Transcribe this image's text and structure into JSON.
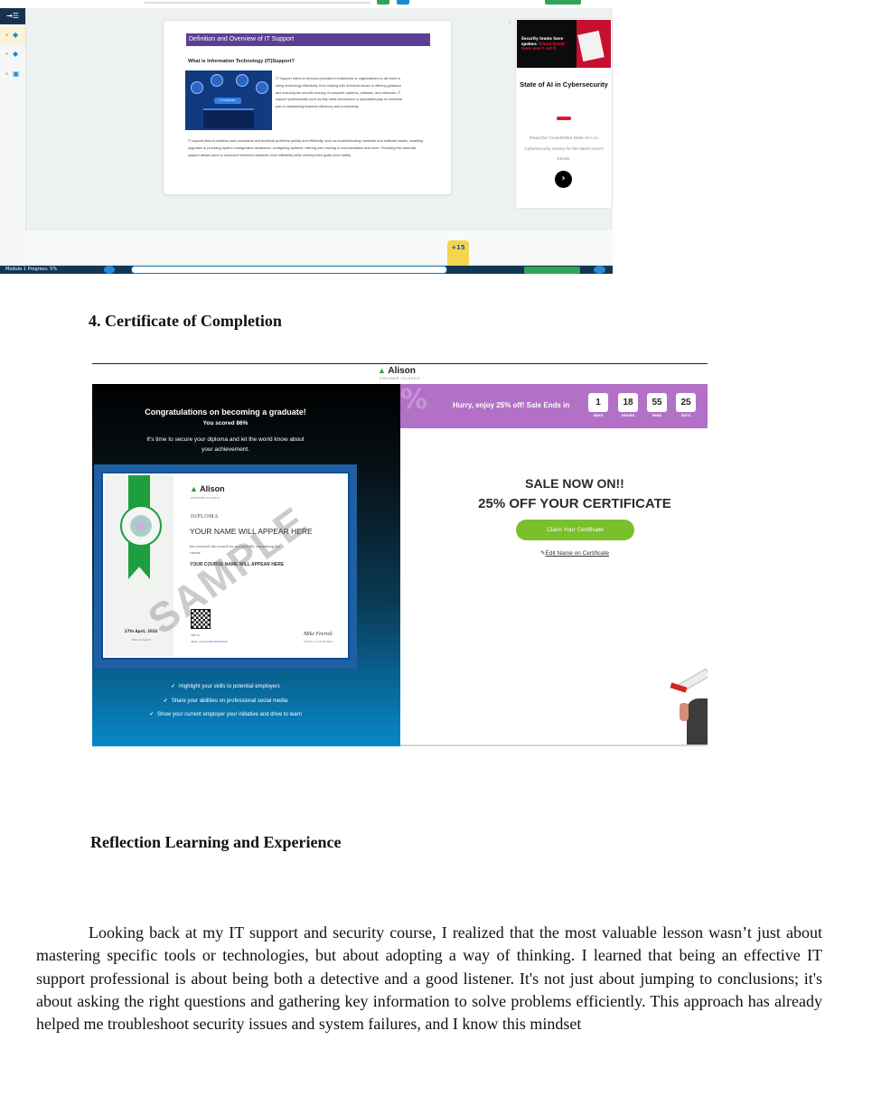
{
  "screenshot1": {
    "lesson_title": "Definition and Overview of IT Support",
    "question": "What is Information Technology (IT)Support?",
    "image_tag": "IT SUPPORT",
    "paragraph1": "IT Support refers to services provided to individuals or organizations to aid them in using technology effectively, from helping with technical issues to offering guidance and ensuring the smooth running of computer systems, software, and networks. IT support professionals such as help desk technicians or specialists play an essential part in maintaining business efficiency and productivity.",
    "paragraph2": "IT support aims to address user complaints and technical problems quickly and efficiently, such as troubleshooting hardware and software issues, installing upgrades or providing system configuration assistance, configuring systems, offering user training or documentation and more. Providing this essential support allows users to overcome technical obstacles more efficiently while meeting their goals more swiftly.",
    "ad_image_text": "Security teams have spoken:",
    "ad_image_highlight": "Siloed GenAI tools won't cut it.",
    "ad_title": "State of AI in Cybersecurity",
    "ad_body": "Read the CrowdStrike State of AI in Cybersecurity survey for the latest GenAI trends.",
    "xp_badge": "+15",
    "bottom_label": "Module 1 Progress: 5%"
  },
  "section_heading": "4. Certificate of Completion",
  "screenshot2": {
    "brand": "Alison",
    "brand_tagline": "EMPOWER YOURSELF",
    "congrats": "Congratulations on becoming a graduate!",
    "score": "You scored 86%",
    "secure_text": "It's time to secure your diploma and let the world know about your achievement.",
    "certificate": {
      "logo": "Alison",
      "logo_tagline": "EMPOWER YOURSELF",
      "diploma": "DIPLOMA",
      "name": "YOUR NAME WILL APPEAR HERE",
      "received": "has received this award for successfully completing the course",
      "course": "YOUR COURSE NAME WILL APPEAR HERE",
      "watermark": "SAMPLE",
      "date": "27th April, 2024",
      "date_label": "Date of Award",
      "qr_label": "CERT ID",
      "url": "alison.com/certificate/XXXXX",
      "signature": "Mike Feerick",
      "signature_label": "Director of Certification"
    },
    "benefits": [
      "Highlight your skills to potential employers",
      "Share your abilities on professional social media",
      "Show your current employer your initiative and drive to learn"
    ],
    "sale_banner": "Hurry, enjoy 25% off! Sale Ends in",
    "countdown": [
      {
        "value": "1",
        "label": "DAYS"
      },
      {
        "value": "18",
        "label": "HOURS"
      },
      {
        "value": "55",
        "label": "MINS"
      },
      {
        "value": "25",
        "label": "SECS"
      }
    ],
    "sale_now": "SALE NOW ON!!",
    "discount": "25% OFF YOUR CERTIFICATE",
    "claim_button": "Claim Your Certificate",
    "edit_link": "Edit Name on Certificate"
  },
  "reflection_heading": "Reflection Learning and Experience",
  "reflection_paragraph": "Looking back at my IT support and security course, I realized that the most valuable lesson wasn’t just about mastering specific tools or technologies, but about adopting a way of thinking. I learned that being an effective IT support professional is about being both a detective and a good listener. It's not just about jumping to conclusions; it's about asking the right questions and gathering key information to solve problems efficiently. This approach has already helped me troubleshoot security issues and system failures, and I know this mindset",
  "colors": {
    "lesson_header": "#5c3f92",
    "sale_banner": "#b271c7",
    "claim_button": "#79c02c",
    "cert_ribbon": "#1e9e3f",
    "nav_bar": "#113755"
  }
}
